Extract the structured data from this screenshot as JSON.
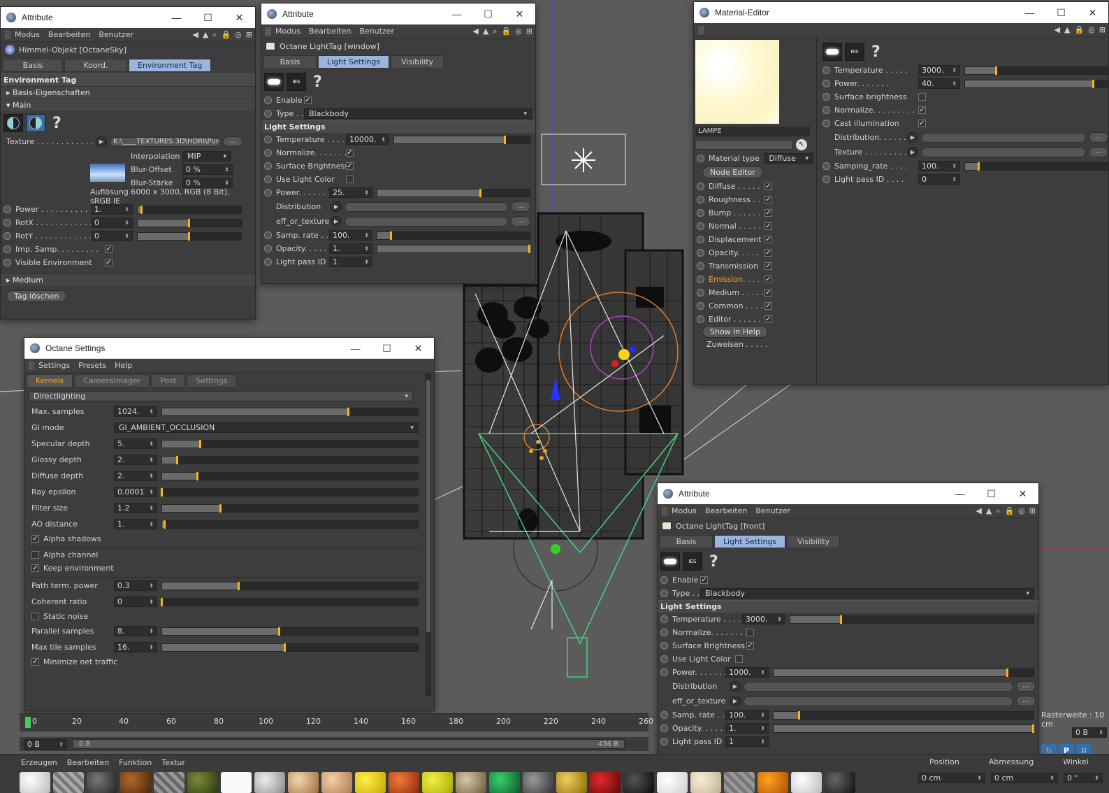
{
  "attr1": {
    "title": "Attribute",
    "menu": [
      "Modus",
      "Bearbeiten",
      "Benutzer"
    ],
    "object": "Himmel-Objekt [OctaneSky]",
    "tabs": [
      "Basis",
      "Koord.",
      "Environment Tag"
    ],
    "section": "Environment Tag",
    "groups": [
      "Basis-Eigenschaften",
      "Main",
      "Medium"
    ],
    "texture_label": "Texture . . . . . . . . . . . .",
    "texture_path": "K:\\____TEXTURES 3D\\HDRI\\Pure",
    "interpolation_label": "Interpolation",
    "interpolation_value": "MIP",
    "blur_offset_label": "Blur-Offset",
    "blur_offset_value": "0 %",
    "blur_staerke_label": "Blur-Stärke",
    "blur_staerke_value": "0 %",
    "resolution": "Auflösung 6000 x 3000, RGB (8 Bit), sRGB IE",
    "rows": [
      {
        "label": "Power . . . . . . . . . . . .",
        "value": "1.",
        "level": 0.04
      },
      {
        "label": "RotX . . . . . . . . . . . .",
        "value": "0",
        "level": 0.5
      },
      {
        "label": "RotY . . . . . . . . . . . .",
        "value": "0",
        "level": 0.5
      }
    ],
    "imp_samp": "Imp. Samp. . . . . . . . .",
    "visible_env": "Visible Environment",
    "delete_btn": "Tag löschen"
  },
  "attr2": {
    "title": "Attribute",
    "menu": [
      "Modus",
      "Bearbeiten",
      "Benutzer"
    ],
    "object": "Octane LightTag [window]",
    "tabs": [
      "Basis",
      "Light Settings",
      "Visibility"
    ],
    "enable": "Enable",
    "type_label": "Type . .",
    "type_value": "Blackbody",
    "section": "Light Settings",
    "temperature": {
      "label": "Temperature . . . . .",
      "value": "10000.",
      "level": 0.82
    },
    "normalize": "Normalize. . . . . . . .",
    "surface_brightness": "Surface Brightness",
    "use_light_color": "Use Light Color",
    "power": {
      "label": "Power. . . . . . .",
      "value": "25.",
      "level": 0.68
    },
    "distribution": "Distribution",
    "eff_or_texture": "eff_or_texture",
    "samp_rate": {
      "label": "Samp. rate . . .",
      "value": "100.",
      "level": 0.09
    },
    "opacity": {
      "label": "Opacity. . . . . .",
      "value": "1.",
      "level": 1.0
    },
    "light_pass": {
      "label": "Light pass ID",
      "value": "1"
    }
  },
  "octane": {
    "title": "Octane Settings",
    "menu": [
      "Settings",
      "Presets",
      "Help"
    ],
    "tabs": [
      "Kernels",
      "CameraImager",
      "Post",
      "Settings"
    ],
    "kernel": "Directlighting",
    "rows": [
      {
        "label": "Max. samples",
        "value": "1024.",
        "level": 0.73
      },
      {
        "label": "Specular depth",
        "value": "5.",
        "level": 0.15
      },
      {
        "label": "Glossy depth",
        "value": "2.",
        "level": 0.06
      },
      {
        "label": "Diffuse depth",
        "value": "2.",
        "level": 0.14
      },
      {
        "label": "Ray epsilon",
        "value": "0.0001",
        "level": 0.0
      },
      {
        "label": "Filter size",
        "value": "1.2",
        "level": 0.23
      },
      {
        "label": "AO distance",
        "value": "1.",
        "level": 0.01
      }
    ],
    "gi_mode_label": "GI mode",
    "gi_mode_value": "GI_AMBIENT_OCCLUSION",
    "alpha_shadows": "Alpha shadows",
    "alpha_channel": "Alpha channel",
    "keep_environment": "Keep environment",
    "rows2": [
      {
        "label": "Path term. power",
        "value": "0.3",
        "level": 0.3
      },
      {
        "label": "Coherent ratio",
        "value": "0",
        "level": 0.0
      }
    ],
    "static_noise": "Static noise",
    "rows3": [
      {
        "label": "Parallel samples",
        "value": "8.",
        "level": 0.46
      },
      {
        "label": "Max tile samples",
        "value": "16.",
        "level": 0.48
      }
    ],
    "minimize_net": "Minimize net traffic"
  },
  "material": {
    "title": "Material-Editor",
    "name": "LAMPE",
    "material_type_label": "Material type",
    "material_type_value": "Diffuse",
    "node_editor": "Node Editor",
    "channels": [
      "Diffuse . . . . .",
      "Roughness . .",
      "Bump . . . . . .",
      "Normal . . . . .",
      "Displacement",
      "Opacity. . . . .",
      "Transmission",
      "Emission. . . .",
      "Medium . . . . .",
      "Common . . . .",
      "Editor . . . . . ."
    ],
    "show_help": "Show In Help",
    "zuweisen": "Zuweisen . . . . .",
    "temperature": {
      "label": "Temperature . . . . .",
      "value": "3000.",
      "level": 0.2
    },
    "power": {
      "label": "Power. . . . . . .",
      "value": "40.",
      "level": 0.82
    },
    "surface_brightness": "Surface brightness",
    "normalize": "Normalize. . . . . . . . .",
    "cast_illumination": "Cast illumination",
    "distribution": "Distribution. . . . . .",
    "texture": "Texture . . . . . . . . .",
    "samping_rate": {
      "label": "Samping_rate . . . .",
      "value": "100.",
      "level": 0.09
    },
    "light_pass": {
      "label": "Light pass ID . . . .",
      "value": "0"
    }
  },
  "attr3": {
    "title": "Attribute",
    "menu": [
      "Modus",
      "Bearbeiten",
      "Benutzer"
    ],
    "object": "Octane LightTag [front]",
    "tabs": [
      "Basis",
      "Light Settings",
      "Visibility"
    ],
    "enable": "Enable",
    "type_label": "Type . .",
    "type_value": "Blackbody",
    "section": "Light Settings",
    "temperature": {
      "label": "Temperature . . . . .",
      "value": "3000.",
      "level": 0.21
    },
    "normalize": "Normalize. . . . . . . .",
    "surface_brightness": "Surface Brightness",
    "use_light_color": "Use Light Color",
    "power": {
      "label": "Power. . . . . . .",
      "value": "1000.",
      "level": 0.9
    },
    "distribution": "Distribution",
    "eff_or_texture": "eff_or_texture",
    "samp_rate": {
      "label": "Samp. rate . . .",
      "value": "100.",
      "level": 0.1
    },
    "opacity": {
      "label": "Opacity. . . . . .",
      "value": "1.",
      "level": 1.0
    },
    "light_pass": {
      "label": "Light pass ID",
      "value": "1"
    }
  },
  "timeline": {
    "ticks": [
      "0",
      "20",
      "40",
      "60",
      "80",
      "100",
      "120",
      "140",
      "160",
      "180",
      "200",
      "220",
      "240",
      "260"
    ],
    "frame_left": "0 B",
    "frame_mid": "0 B",
    "frame_right": "436 B"
  },
  "bottom": {
    "menu": [
      "Erzeugen",
      "Bearbeiten",
      "Funktion",
      "Textur"
    ],
    "coord_headers": [
      "Position",
      "Abmessung",
      "Winkel"
    ],
    "coord_x": "0 cm",
    "coord_x2": "0 cm",
    "coord_h": "0 °",
    "rasterweite": "Rasterweite : 10 cm",
    "right_frame": "0 B"
  }
}
